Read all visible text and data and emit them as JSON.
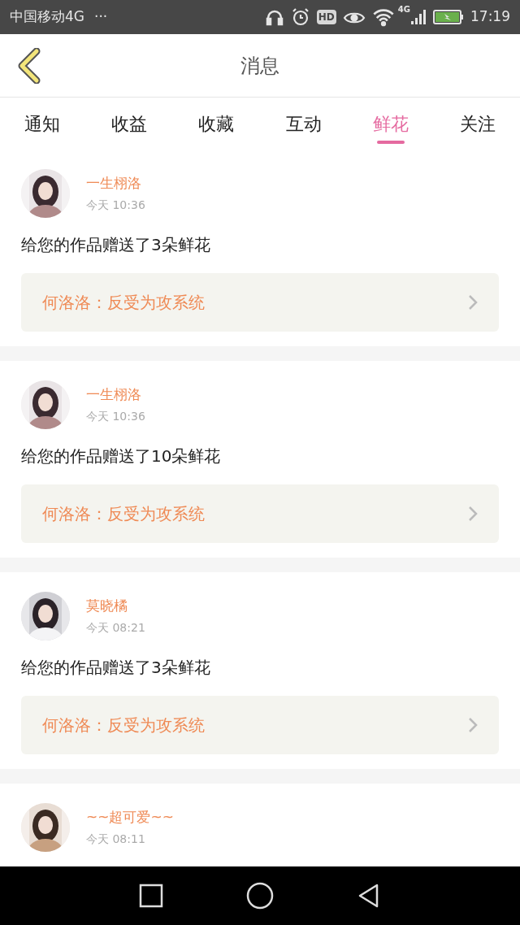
{
  "status_bar": {
    "carrier": "中国移动4G",
    "more": "···",
    "hd": "HD",
    "network": "4G",
    "time": "17:19"
  },
  "header": {
    "title": "消息"
  },
  "tabs": [
    {
      "label": "通知",
      "selected": false
    },
    {
      "label": "收益",
      "selected": false
    },
    {
      "label": "收藏",
      "selected": false
    },
    {
      "label": "互动",
      "selected": false
    },
    {
      "label": "鲜花",
      "selected": true
    },
    {
      "label": "关注",
      "selected": false
    }
  ],
  "messages": [
    {
      "user": "一生栩洛",
      "time": "今天 10:36",
      "text": "给您的作品赠送了3朵鲜花",
      "work": "何洛洛：反受为攻系统"
    },
    {
      "user": "一生栩洛",
      "time": "今天 10:36",
      "text": "给您的作品赠送了10朵鲜花",
      "work": "何洛洛：反受为攻系统"
    },
    {
      "user": "莫晓橘",
      "time": "今天 08:21",
      "text": "给您的作品赠送了3朵鲜花",
      "work": "何洛洛：反受为攻系统"
    },
    {
      "user": "~~超可爱~~",
      "time": "今天 08:11"
    }
  ]
}
